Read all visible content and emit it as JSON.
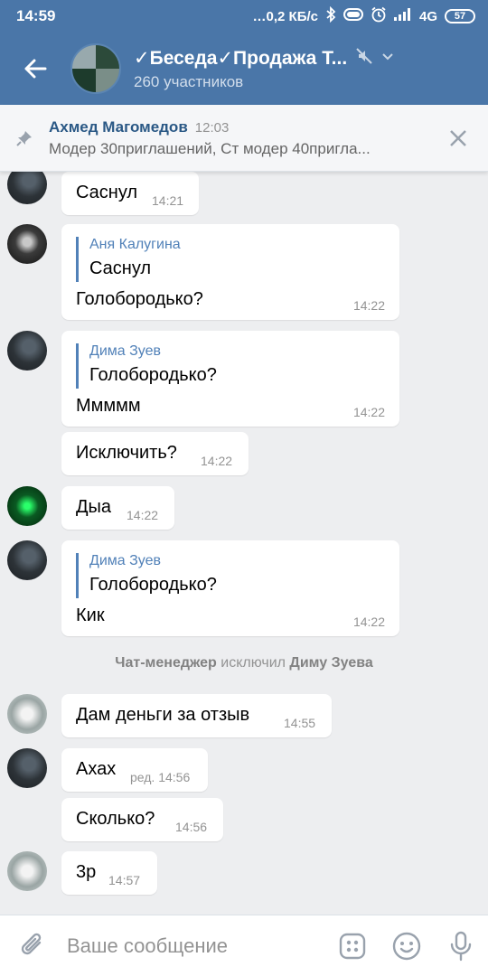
{
  "status_bar": {
    "time": "14:59",
    "speed": "…0,2 КБ/с",
    "network": "4G",
    "battery": "57"
  },
  "header": {
    "title": "✓Беседа✓Продажа Т...",
    "subtitle": "260 участников"
  },
  "pinned": {
    "author": "Ахмед Магомедов",
    "time": "12:03",
    "text": "Модер 30приглашений, Ст модер 40пригла..."
  },
  "messages": [
    {
      "text": "Саснул",
      "time": "14:21"
    },
    {
      "reply_name": "Аня Калугина",
      "reply_text": "Саснул",
      "text": "Голобородько?",
      "time": "14:22"
    },
    {
      "reply_name": "Дима Зуев",
      "reply_text": "Голобородько?",
      "text": "Ммммм",
      "time": "14:22"
    },
    {
      "text": "Исключить?",
      "time": "14:22"
    },
    {
      "text": "Дыа",
      "time": "14:22"
    },
    {
      "reply_name": "Дима Зуев",
      "reply_text": "Голобородько?",
      "text": "Кик",
      "time": "14:22"
    },
    {
      "text": "Дам деньги за отзыв",
      "time": "14:55"
    },
    {
      "text": "Ахах",
      "time": "ред. 14:56"
    },
    {
      "text": "Сколько?",
      "time": "14:56"
    },
    {
      "text": "3р",
      "time": "14:57"
    }
  ],
  "system_message": {
    "actor": "Чат-менеджер",
    "action": "исключил",
    "target": "Диму Зуева"
  },
  "input": {
    "placeholder": "Ваше сообщение"
  },
  "colors": {
    "header": "#4a76a8",
    "background": "#edeef0",
    "reply_accent": "#5181b8",
    "link_name": "#2a5885"
  }
}
